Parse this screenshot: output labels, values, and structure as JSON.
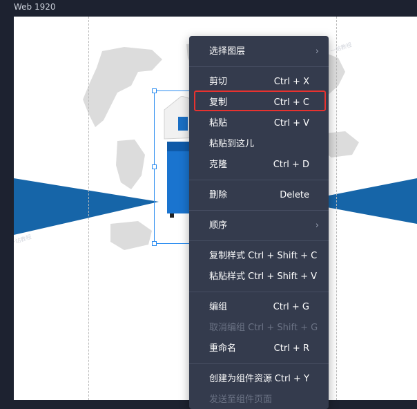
{
  "frame": {
    "title": "Web 1920"
  },
  "watermark": "一站教程",
  "colors": {
    "menu_bg": "#343b4d",
    "highlight": "#e8322f",
    "selection": "#2a8cf0",
    "banner": "#1665a8"
  },
  "context_menu": {
    "items": [
      {
        "label": "选择图层",
        "shortcut": "",
        "submenu": true,
        "disabled": false,
        "icon": "chevron-right-icon"
      },
      {
        "label": "剪切",
        "shortcut": "Ctrl + X",
        "submenu": false,
        "disabled": false
      },
      {
        "label": "复制",
        "shortcut": "Ctrl + C",
        "submenu": false,
        "disabled": false,
        "highlighted": true
      },
      {
        "label": "粘贴",
        "shortcut": "Ctrl + V",
        "submenu": false,
        "disabled": false
      },
      {
        "label": "粘贴到这儿",
        "shortcut": "",
        "submenu": false,
        "disabled": false
      },
      {
        "label": "克隆",
        "shortcut": "Ctrl + D",
        "submenu": false,
        "disabled": false
      },
      {
        "label": "删除",
        "shortcut": "Delete",
        "submenu": false,
        "disabled": false
      },
      {
        "label": "顺序",
        "shortcut": "",
        "submenu": true,
        "disabled": false,
        "icon": "chevron-right-icon"
      },
      {
        "label": "复制样式 Ctrl + Shift + C",
        "shortcut": "",
        "submenu": false,
        "disabled": false
      },
      {
        "label": "粘贴样式 Ctrl + Shift + V",
        "shortcut": "",
        "submenu": false,
        "disabled": false
      },
      {
        "label": "编组",
        "shortcut": "Ctrl + G",
        "submenu": false,
        "disabled": false
      },
      {
        "label": "取消编组 Ctrl + Shift + G",
        "shortcut": "",
        "submenu": false,
        "disabled": true
      },
      {
        "label": "重命名",
        "shortcut": "Ctrl + R",
        "submenu": false,
        "disabled": false
      },
      {
        "label": "创建为组件资源",
        "shortcut": "Ctrl + Y",
        "submenu": false,
        "disabled": false
      },
      {
        "label": "发送至组件页面",
        "shortcut": "",
        "submenu": false,
        "disabled": true
      }
    ]
  }
}
